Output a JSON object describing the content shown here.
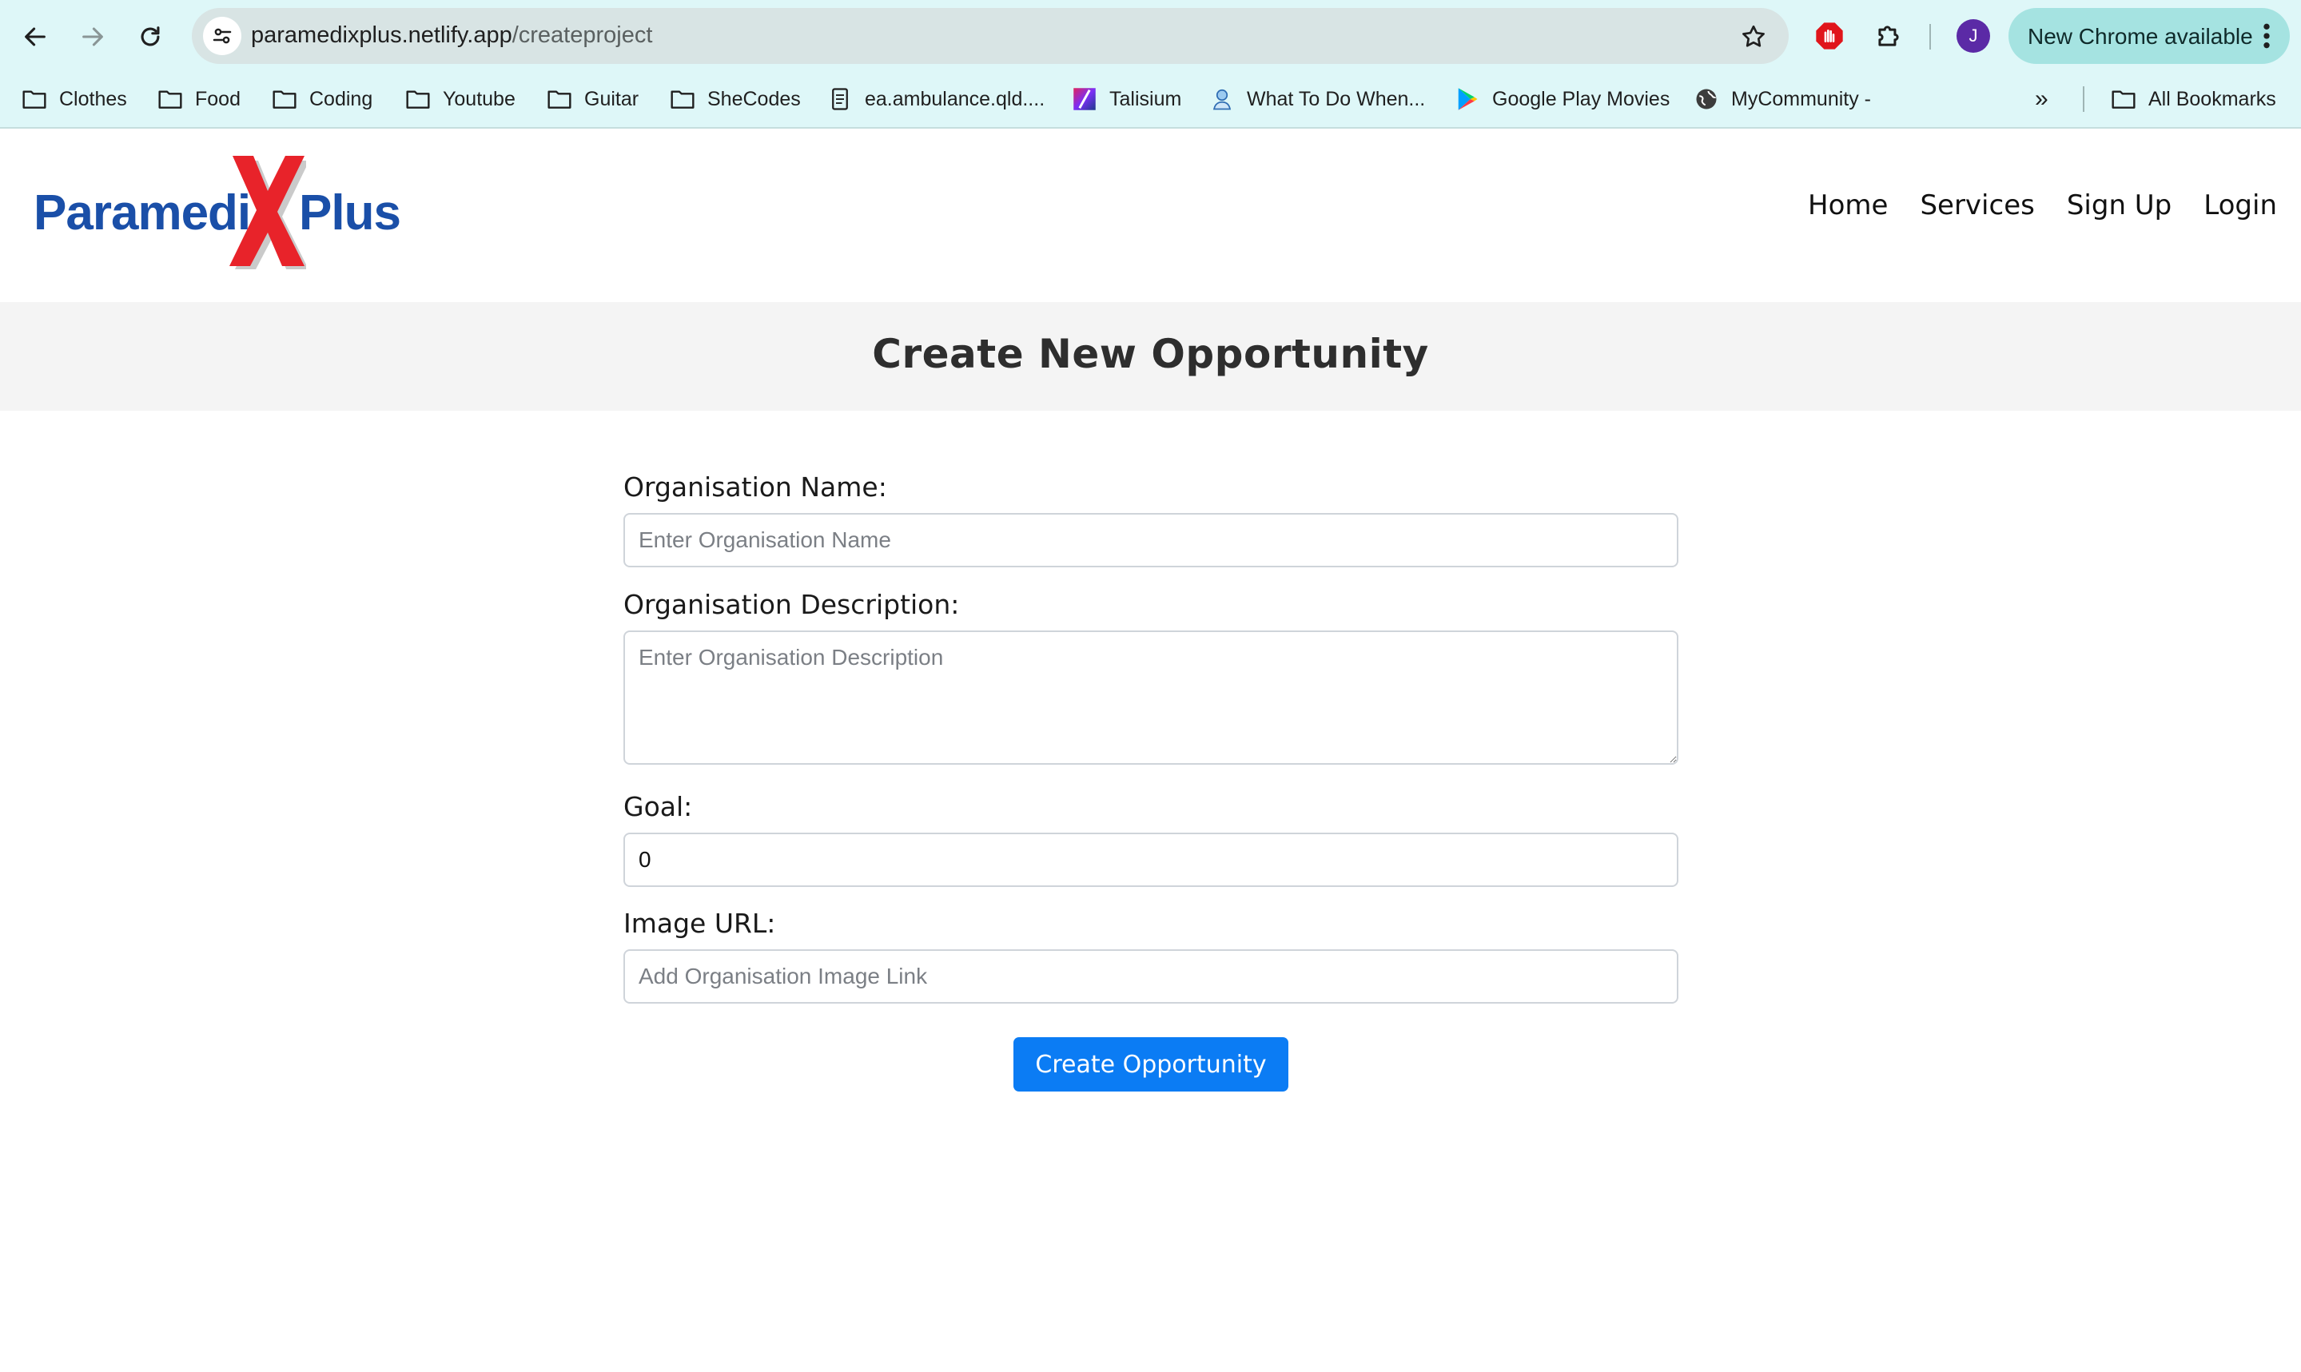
{
  "browser": {
    "url_domain": "paramedixplus.netlify.app",
    "url_path": "/createproject",
    "update_label": "New Chrome available",
    "avatar_initial": "J",
    "bookmarks": [
      {
        "label": "Clothes",
        "icon": "folder-icon"
      },
      {
        "label": "Food",
        "icon": "folder-icon"
      },
      {
        "label": "Coding",
        "icon": "folder-icon"
      },
      {
        "label": "Youtube",
        "icon": "folder-icon"
      },
      {
        "label": "Guitar",
        "icon": "folder-icon"
      },
      {
        "label": "SheCodes",
        "icon": "folder-icon"
      },
      {
        "label": "ea.ambulance.qld....",
        "icon": "page-icon"
      },
      {
        "label": "Talisium",
        "icon": "talisium-icon"
      },
      {
        "label": "What To Do When...",
        "icon": "person-icon"
      },
      {
        "label": "Google Play Movies",
        "icon": "play-icon"
      },
      {
        "label": "MyCommunity -",
        "icon": "globe-icon"
      }
    ],
    "overflow_label": "»",
    "all_bookmarks_label": "All Bookmarks"
  },
  "site": {
    "logo": {
      "left": "Paramedi",
      "right": "Plus",
      "x_letter": "X"
    },
    "nav": [
      "Home",
      "Services",
      "Sign Up",
      "Login"
    ]
  },
  "page": {
    "title": "Create New Opportunity"
  },
  "form": {
    "org_name": {
      "label": "Organisation Name:",
      "placeholder": "Enter Organisation Name",
      "value": ""
    },
    "org_description": {
      "label": "Organisation Description:",
      "placeholder": "Enter Organisation Description",
      "value": ""
    },
    "goal": {
      "label": "Goal:",
      "value": "0"
    },
    "image_url": {
      "label": "Image URL:",
      "placeholder": "Add Organisation Image Link",
      "value": ""
    },
    "submit_label": "Create Opportunity"
  },
  "colors": {
    "chrome_bg": "#def7f8",
    "omnibox_bg": "#d8e4e4",
    "logo_blue": "#1a4fa8",
    "logo_red": "#e8232a",
    "button_blue": "#0b7cf4",
    "title_band": "#f4f4f4"
  }
}
